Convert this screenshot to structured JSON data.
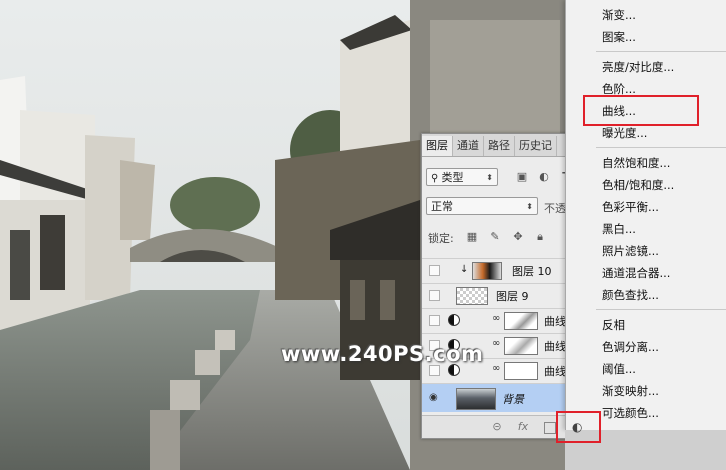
{
  "watermark": "www.240PS.com",
  "layers_panel": {
    "tabs": [
      "图层",
      "通道",
      "路径",
      "历史记"
    ],
    "filter_kind": "类型",
    "blend_mode": "正常",
    "opacity_label": "不透",
    "lock_label": "锁定:",
    "layers": [
      {
        "name": "图层 10",
        "visible": false,
        "type": "clipped"
      },
      {
        "name": "图层 9",
        "visible": false,
        "type": "pixel"
      },
      {
        "name": "曲线",
        "visible": false,
        "type": "adjustment"
      },
      {
        "name": "曲线",
        "visible": false,
        "type": "adjustment"
      },
      {
        "name": "曲线",
        "visible": false,
        "type": "adjustment"
      },
      {
        "name": "背景",
        "visible": true,
        "type": "background",
        "selected": true
      }
    ],
    "bottom_icons": [
      "link-icon",
      "fx-icon",
      "mask-icon"
    ]
  },
  "adjust_menu": {
    "items_group1": [
      "渐变...",
      "图案..."
    ],
    "items_group2": [
      "亮度/对比度...",
      "色阶...",
      "曲线...",
      "曝光度..."
    ],
    "items_group3": [
      "自然饱和度...",
      "色相/饱和度...",
      "色彩平衡...",
      "黑白...",
      "照片滤镜...",
      "通道混合器...",
      "颜色查找..."
    ],
    "items_group4": [
      "反相",
      "色调分离...",
      "阈值...",
      "渐变映射...",
      "可选颜色..."
    ],
    "highlighted": "曲线..."
  },
  "colors": {
    "highlight_box": "#e0202a",
    "selected_layer": "#b4cff3"
  }
}
